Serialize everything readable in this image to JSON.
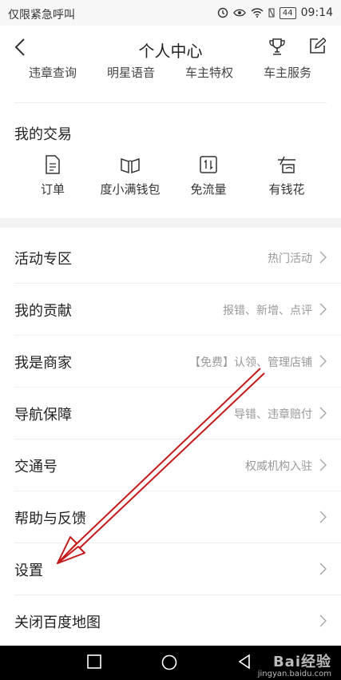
{
  "status_bar": {
    "carrier": "仅限紧急呼叫",
    "battery": "44",
    "time": "09:14"
  },
  "header": {
    "title": "个人中心"
  },
  "cut_row": [
    "违章查询",
    "明星语音",
    "车主特权",
    "车主服务"
  ],
  "transactions": {
    "title": "我的交易",
    "items": [
      {
        "label": "订单",
        "icon": "document-icon"
      },
      {
        "label": "度小满钱包",
        "icon": "wallet-book-icon"
      },
      {
        "label": "免流量",
        "icon": "data-transfer-icon"
      },
      {
        "label": "有钱花",
        "icon": "money-icon"
      }
    ]
  },
  "menu": [
    {
      "title": "活动专区",
      "hint": "热门活动"
    },
    {
      "title": "我的贡献",
      "hint": "报错、新增、点评"
    },
    {
      "title": "我是商家",
      "hint": "【免费】认领、管理店铺"
    },
    {
      "title": "导航保障",
      "hint": "导错、违章赔付"
    },
    {
      "title": "交通号",
      "hint": "权威机构入驻"
    },
    {
      "title": "帮助与反馈",
      "hint": ""
    },
    {
      "title": "设置",
      "hint": ""
    },
    {
      "title": "关闭百度地图",
      "hint": ""
    }
  ],
  "watermark": {
    "logo": "Bai经验",
    "url": "jingyan.baidu.com"
  },
  "colors": {
    "annotation_arrow": "#c41a1a",
    "divider_band": "#f2f2f2",
    "hint_text": "#999999"
  }
}
